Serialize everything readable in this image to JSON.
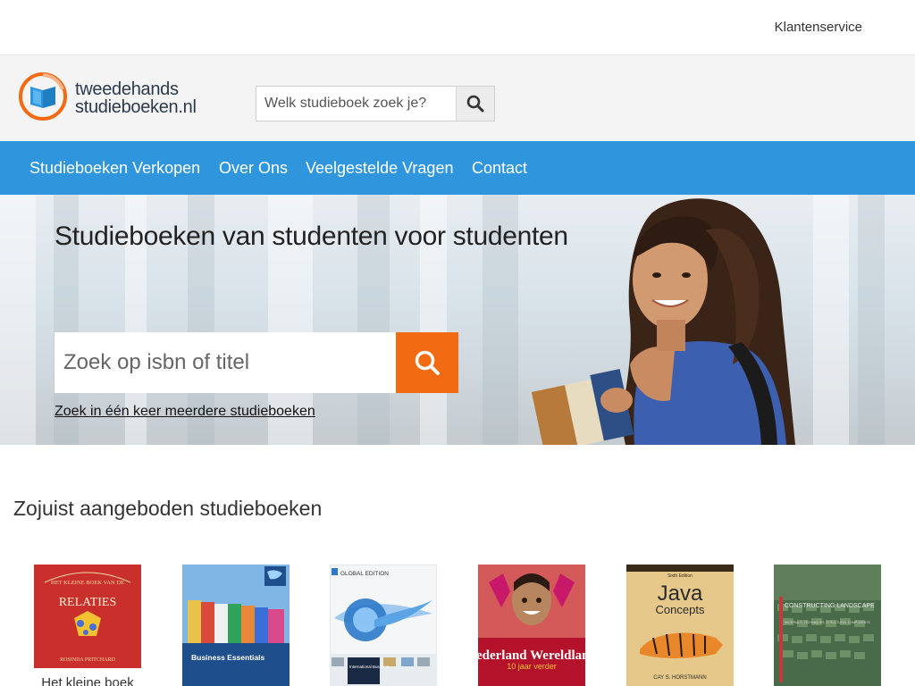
{
  "topbar": {
    "customer_service": "Klantenservice"
  },
  "logo": {
    "line1": "tweedehands",
    "line2": "studieboeken.nl"
  },
  "header_search": {
    "placeholder": "Welk studieboek zoek je?",
    "icon": "search-icon"
  },
  "nav": {
    "items": [
      {
        "label": "Studieboeken Verkopen"
      },
      {
        "label": "Over Ons"
      },
      {
        "label": "Veelgestelde Vragen"
      },
      {
        "label": "Contact"
      }
    ]
  },
  "hero": {
    "title": "Studieboeken van studenten voor studenten",
    "search_placeholder": "Zoek op isbn of titel",
    "search_icon": "search-icon",
    "multi_link": "Zoek in één keer meerdere studieboeken"
  },
  "recent": {
    "title": "Zojuist aangeboden studieboeken",
    "books": [
      {
        "title": "Het kleine boek",
        "cover_title": "RELATIES",
        "cover_top": "HET KLEINE BOEK VAN DE",
        "cover_author": "ROSINDA PRITCHARD",
        "color": "#c9302c"
      },
      {
        "cover_title": "Business Essentials",
        "color": "#1e4f8c"
      },
      {
        "cover_badge": "GLOBAL EDITION",
        "cover_title": "International Business",
        "color": "#2c7ac9"
      },
      {
        "cover_title": "Nederland Wereldland",
        "cover_sub": "10 jaar verder",
        "color": "#b3122a"
      },
      {
        "cover_edition": "Sixth Edition",
        "cover_title": "Java",
        "cover_sub": "Concepts",
        "cover_author": "CAY S. HORSTMANN",
        "color": "#d9a441"
      },
      {
        "cover_title": "CONSTRUCTING LANDSCAPE",
        "cover_sub": "MATERIALS, TECHNIQUES, STRUCTURAL COMPONENTS",
        "color": "#4a6b4a"
      }
    ]
  },
  "colors": {
    "nav_bg": "#2f96dd",
    "search_button": "#f26a12",
    "logo_orange": "#f26a12",
    "logo_blue": "#2f96dd"
  }
}
